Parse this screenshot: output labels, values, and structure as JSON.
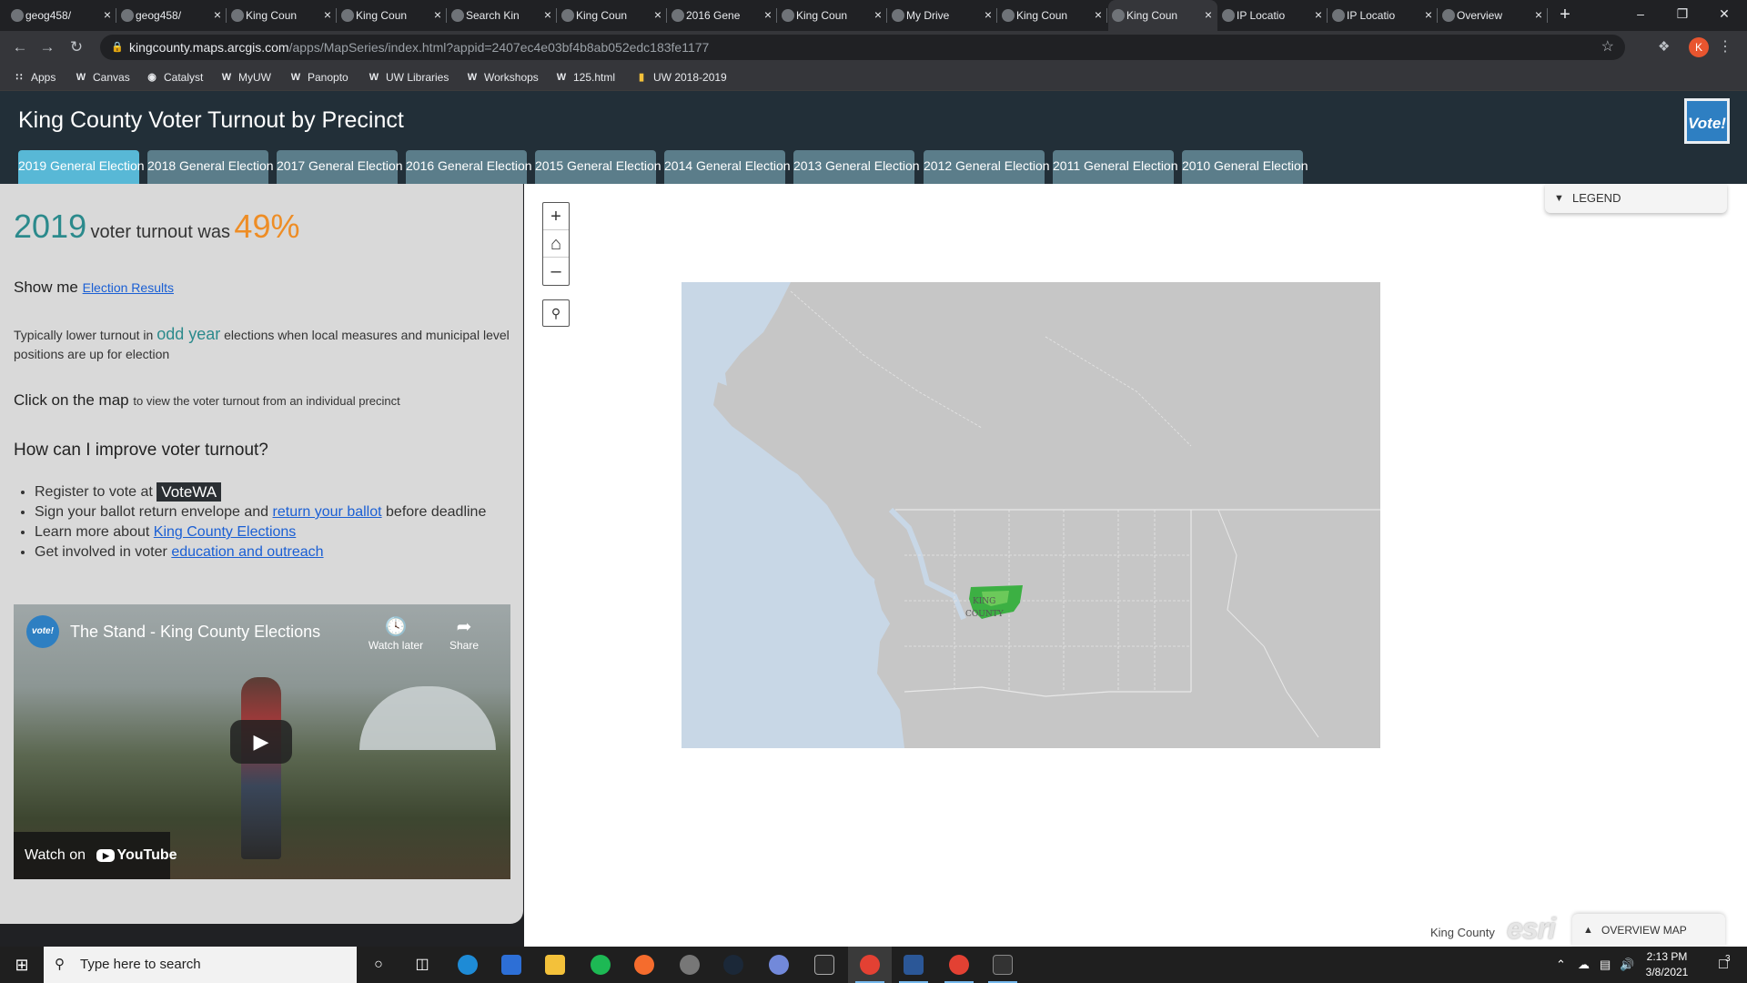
{
  "browser": {
    "tabs": [
      {
        "title": "geog458/",
        "active": false
      },
      {
        "title": "geog458/",
        "active": false
      },
      {
        "title": "King Coun",
        "active": false
      },
      {
        "title": "King Coun",
        "active": false
      },
      {
        "title": "Search Kin",
        "active": false
      },
      {
        "title": "King Coun",
        "active": false
      },
      {
        "title": "2016 Gene",
        "active": false
      },
      {
        "title": "King Coun",
        "active": false
      },
      {
        "title": "My Drive",
        "active": false
      },
      {
        "title": "King Coun",
        "active": false
      },
      {
        "title": "King Coun",
        "active": true
      },
      {
        "title": "IP Locatio",
        "active": false
      },
      {
        "title": "IP Locatio",
        "active": false
      },
      {
        "title": "Overview",
        "active": false
      }
    ],
    "url_host": "kingcounty.maps.arcgis.com",
    "url_path": "/apps/MapSeries/index.html?appid=2407ec4e03bf4b8ab052edc183fe1177",
    "profile_initial": "K",
    "bookmarks": [
      {
        "label": "Apps",
        "icon": "apps-grid-icon"
      },
      {
        "label": "Canvas",
        "icon": "W"
      },
      {
        "label": "Catalyst",
        "icon": "catalyst-icon"
      },
      {
        "label": "MyUW",
        "icon": "W"
      },
      {
        "label": "Panopto",
        "icon": "W"
      },
      {
        "label": "UW Libraries",
        "icon": "W"
      },
      {
        "label": "Workshops",
        "icon": "W"
      },
      {
        "label": "125.html",
        "icon": "W"
      },
      {
        "label": "UW 2018-2019",
        "icon": "folder-icon"
      }
    ]
  },
  "app": {
    "title": "King County Voter Turnout by Precinct",
    "logo_text": "Vote!",
    "election_tabs": [
      {
        "label": "2019 General Election",
        "active": true
      },
      {
        "label": "2018 General Election",
        "active": false
      },
      {
        "label": "2017 General Election",
        "active": false
      },
      {
        "label": "2016 General Election",
        "active": false
      },
      {
        "label": "2015 General Election",
        "active": false
      },
      {
        "label": "2014 General Election",
        "active": false
      },
      {
        "label": "2013 General Election",
        "active": false
      },
      {
        "label": "2012 General Election",
        "active": false
      },
      {
        "label": "2011 General Election",
        "active": false
      },
      {
        "label": "2010 General Election",
        "active": false
      }
    ]
  },
  "panel": {
    "year": "2019",
    "turnout_text": "voter turnout was",
    "turnout_pct": "49%",
    "show_me": "Show me",
    "election_results_link": "Election Results",
    "typical_pre": "Typically lower turnout in",
    "typical_em": "odd year",
    "typical_post": "elections when local measures and municipal level positions are up for election",
    "click_map_bold": "Click on the map",
    "click_map_rest": "to view the voter turnout from an individual precinct",
    "improve_heading": "How can I improve voter turnout?",
    "tip1_text": "Register to vote at",
    "tip1_badge": "VoteWA",
    "tip2_pre": "Sign your ballot return envelope and",
    "tip2_link": "return your ballot",
    "tip2_post": "before deadline",
    "tip3_pre": "Learn more about",
    "tip3_link": "King County Elections",
    "tip4_pre": "Get involved in voter",
    "tip4_link": "education and outreach",
    "video": {
      "title": "The Stand - King County Elections",
      "channel_logo": "vote!",
      "watch_later": "Watch later",
      "share": "Share",
      "watch_on": "Watch on",
      "youtube": "YouTube"
    }
  },
  "map": {
    "legend_label": "LEGEND",
    "overview_label": "OVERVIEW MAP",
    "attribution": "King County",
    "esri": "esri",
    "county_label_1": "KING",
    "county_label_2": "COUNTY",
    "colors": {
      "water": "#c8d7e6",
      "land": "#c6c6c6",
      "turnout_high": "#3cb043",
      "turnout_mid": "#6cc95a"
    }
  },
  "taskbar": {
    "search_placeholder": "Type here to search",
    "time": "2:13 PM",
    "date": "3/8/2021",
    "notifications": "3"
  }
}
